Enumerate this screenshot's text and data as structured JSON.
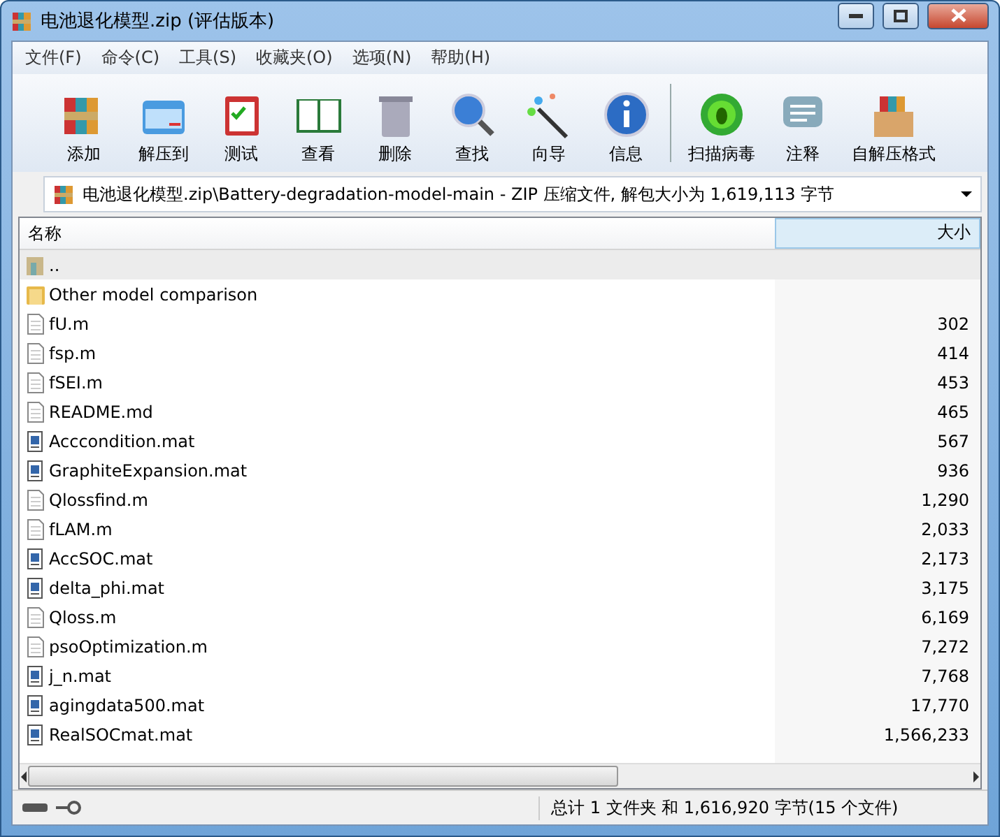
{
  "window": {
    "title": "电池退化模型.zip (评估版本)"
  },
  "menu": [
    "文件(F)",
    "命令(C)",
    "工具(S)",
    "收藏夹(O)",
    "选项(N)",
    "帮助(H)"
  ],
  "toolbar": [
    {
      "label": "添加"
    },
    {
      "label": "解压到"
    },
    {
      "label": "测试"
    },
    {
      "label": "查看"
    },
    {
      "label": "删除"
    },
    {
      "label": "查找"
    },
    {
      "label": "向导"
    },
    {
      "label": "信息"
    },
    {
      "label": "扫描病毒"
    },
    {
      "label": "注释"
    },
    {
      "label": "自解压格式"
    }
  ],
  "address": "电池退化模型.zip\\Battery-degradation-model-main - ZIP 压缩文件, 解包大小为 1,619,113 字节",
  "table": {
    "columns": [
      "名称",
      "大小"
    ],
    "rows": [
      {
        "kind": "parent",
        "name": "..",
        "size": "",
        "selected": true
      },
      {
        "kind": "folder",
        "name": "Other model comparison",
        "size": "",
        "selected": false
      },
      {
        "kind": "text",
        "name": "fU.m",
        "size": "302",
        "selected": false
      },
      {
        "kind": "text",
        "name": "fsp.m",
        "size": "414",
        "selected": false
      },
      {
        "kind": "text",
        "name": "fSEI.m",
        "size": "453",
        "selected": false
      },
      {
        "kind": "text",
        "name": "README.md",
        "size": "465",
        "selected": false
      },
      {
        "kind": "data",
        "name": "Acccondition.mat",
        "size": "567",
        "selected": false
      },
      {
        "kind": "data",
        "name": "GraphiteExpansion.mat",
        "size": "936",
        "selected": false
      },
      {
        "kind": "text",
        "name": "Qlossfind.m",
        "size": "1,290",
        "selected": false
      },
      {
        "kind": "text",
        "name": "fLAM.m",
        "size": "2,033",
        "selected": false
      },
      {
        "kind": "data",
        "name": "AccSOC.mat",
        "size": "2,173",
        "selected": false
      },
      {
        "kind": "data",
        "name": "delta_phi.mat",
        "size": "3,175",
        "selected": false
      },
      {
        "kind": "text",
        "name": "Qloss.m",
        "size": "6,169",
        "selected": false
      },
      {
        "kind": "text",
        "name": "psoOptimization.m",
        "size": "7,272",
        "selected": false
      },
      {
        "kind": "data",
        "name": "j_n.mat",
        "size": "7,768",
        "selected": false
      },
      {
        "kind": "data",
        "name": "agingdata500.mat",
        "size": "17,770",
        "selected": false
      },
      {
        "kind": "data",
        "name": "RealSOCmat.mat",
        "size": "1,566,233",
        "selected": false
      }
    ]
  },
  "status_bar": "总计 1 文件夹 和 1,616,920 字节(15 个文件)"
}
